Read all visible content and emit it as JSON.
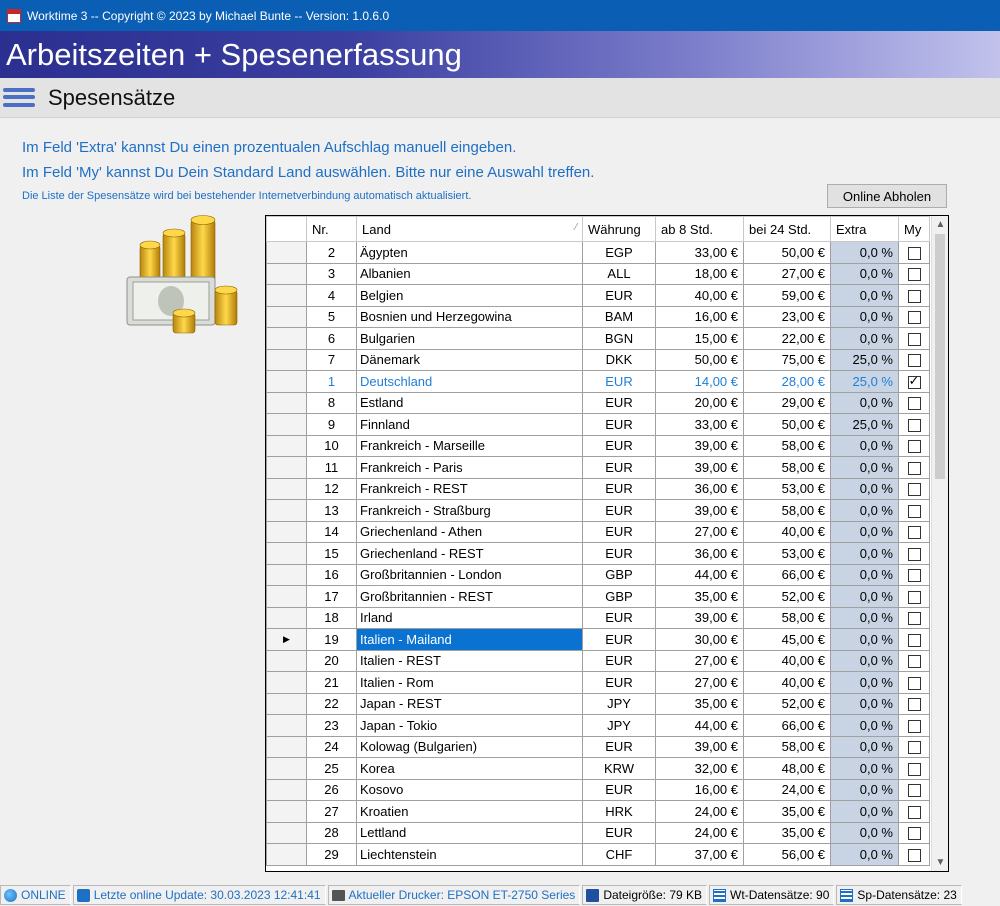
{
  "window": {
    "title": "Worktime 3 -- Copyright © 2023 by Michael Bunte -- Version: 1.0.6.0"
  },
  "banner": {
    "title": "Arbeitszeiten + Spesenerfassung"
  },
  "subheader": {
    "title": "Spesensätze"
  },
  "info": {
    "line1": "Im Feld 'Extra' kannst Du einen prozentualen Aufschlag manuell eingeben.",
    "line2": "Im Feld 'My' kannst Du Dein Standard Land auswählen. Bitte nur eine Auswahl treffen.",
    "line3": "Die Liste der Spesensätze wird bei bestehender Internetverbindung automatisch aktualisiert."
  },
  "buttons": {
    "online": "Online Abholen"
  },
  "grid": {
    "headers": {
      "nr": "Nr.",
      "land": "Land",
      "waehrung": "Währung",
      "ab8": "ab 8 Std.",
      "bei24": "bei 24 Std.",
      "extra": "Extra",
      "my": "My"
    },
    "rows": [
      {
        "nr": "2",
        "land": "Ägypten",
        "cur": "EGP",
        "ab8": "33,00 €",
        "bei24": "50,00 €",
        "extra": "0,0 %",
        "my": false
      },
      {
        "nr": "3",
        "land": "Albanien",
        "cur": "ALL",
        "ab8": "18,00 €",
        "bei24": "27,00 €",
        "extra": "0,0 %",
        "my": false
      },
      {
        "nr": "4",
        "land": "Belgien",
        "cur": "EUR",
        "ab8": "40,00 €",
        "bei24": "59,00 €",
        "extra": "0,0 %",
        "my": false
      },
      {
        "nr": "5",
        "land": "Bosnien und Herzegowina",
        "cur": "BAM",
        "ab8": "16,00 €",
        "bei24": "23,00 €",
        "extra": "0,0 %",
        "my": false
      },
      {
        "nr": "6",
        "land": "Bulgarien",
        "cur": "BGN",
        "ab8": "15,00 €",
        "bei24": "22,00 €",
        "extra": "0,0 %",
        "my": false
      },
      {
        "nr": "7",
        "land": "Dänemark",
        "cur": "DKK",
        "ab8": "50,00 €",
        "bei24": "75,00 €",
        "extra": "25,0 %",
        "my": false
      },
      {
        "nr": "1",
        "land": "Deutschland",
        "cur": "EUR",
        "ab8": "14,00 €",
        "bei24": "28,00 €",
        "extra": "25,0 %",
        "my": true,
        "highlight": true
      },
      {
        "nr": "8",
        "land": "Estland",
        "cur": "EUR",
        "ab8": "20,00 €",
        "bei24": "29,00 €",
        "extra": "0,0 %",
        "my": false
      },
      {
        "nr": "9",
        "land": "Finnland",
        "cur": "EUR",
        "ab8": "33,00 €",
        "bei24": "50,00 €",
        "extra": "25,0 %",
        "my": false
      },
      {
        "nr": "10",
        "land": "Frankreich - Marseille",
        "cur": "EUR",
        "ab8": "39,00 €",
        "bei24": "58,00 €",
        "extra": "0,0 %",
        "my": false
      },
      {
        "nr": "11",
        "land": "Frankreich - Paris",
        "cur": "EUR",
        "ab8": "39,00 €",
        "bei24": "58,00 €",
        "extra": "0,0 %",
        "my": false
      },
      {
        "nr": "12",
        "land": "Frankreich - REST",
        "cur": "EUR",
        "ab8": "36,00 €",
        "bei24": "53,00 €",
        "extra": "0,0 %",
        "my": false
      },
      {
        "nr": "13",
        "land": "Frankreich - Straßburg",
        "cur": "EUR",
        "ab8": "39,00 €",
        "bei24": "58,00 €",
        "extra": "0,0 %",
        "my": false
      },
      {
        "nr": "14",
        "land": "Griechenland - Athen",
        "cur": "EUR",
        "ab8": "27,00 €",
        "bei24": "40,00 €",
        "extra": "0,0 %",
        "my": false
      },
      {
        "nr": "15",
        "land": "Griechenland - REST",
        "cur": "EUR",
        "ab8": "36,00 €",
        "bei24": "53,00 €",
        "extra": "0,0 %",
        "my": false
      },
      {
        "nr": "16",
        "land": "Großbritannien - London",
        "cur": "GBP",
        "ab8": "44,00 €",
        "bei24": "66,00 €",
        "extra": "0,0 %",
        "my": false
      },
      {
        "nr": "17",
        "land": "Großbritannien - REST",
        "cur": "GBP",
        "ab8": "35,00 €",
        "bei24": "52,00 €",
        "extra": "0,0 %",
        "my": false
      },
      {
        "nr": "18",
        "land": "Irland",
        "cur": "EUR",
        "ab8": "39,00 €",
        "bei24": "58,00 €",
        "extra": "0,0 %",
        "my": false
      },
      {
        "nr": "19",
        "land": "Italien - Mailand",
        "cur": "EUR",
        "ab8": "30,00 €",
        "bei24": "45,00 €",
        "extra": "0,0 %",
        "my": false,
        "selected": true
      },
      {
        "nr": "20",
        "land": "Italien - REST",
        "cur": "EUR",
        "ab8": "27,00 €",
        "bei24": "40,00 €",
        "extra": "0,0 %",
        "my": false
      },
      {
        "nr": "21",
        "land": "Italien - Rom",
        "cur": "EUR",
        "ab8": "27,00 €",
        "bei24": "40,00 €",
        "extra": "0,0 %",
        "my": false
      },
      {
        "nr": "22",
        "land": "Japan - REST",
        "cur": "JPY",
        "ab8": "35,00 €",
        "bei24": "52,00 €",
        "extra": "0,0 %",
        "my": false
      },
      {
        "nr": "23",
        "land": "Japan - Tokio",
        "cur": "JPY",
        "ab8": "44,00 €",
        "bei24": "66,00 €",
        "extra": "0,0 %",
        "my": false
      },
      {
        "nr": "24",
        "land": "Kolowag (Bulgarien)",
        "cur": "EUR",
        "ab8": "39,00 €",
        "bei24": "58,00 €",
        "extra": "0,0 %",
        "my": false
      },
      {
        "nr": "25",
        "land": "Korea",
        "cur": "KRW",
        "ab8": "32,00 €",
        "bei24": "48,00 €",
        "extra": "0,0 %",
        "my": false
      },
      {
        "nr": "26",
        "land": "Kosovo",
        "cur": "EUR",
        "ab8": "16,00 €",
        "bei24": "24,00 €",
        "extra": "0,0 %",
        "my": false
      },
      {
        "nr": "27",
        "land": "Kroatien",
        "cur": "HRK",
        "ab8": "24,00 €",
        "bei24": "35,00 €",
        "extra": "0,0 %",
        "my": false
      },
      {
        "nr": "28",
        "land": "Lettland",
        "cur": "EUR",
        "ab8": "24,00 €",
        "bei24": "35,00 €",
        "extra": "0,0 %",
        "my": false
      },
      {
        "nr": "29",
        "land": "Liechtenstein",
        "cur": "CHF",
        "ab8": "37,00 €",
        "bei24": "56,00 €",
        "extra": "0,0 %",
        "my": false
      }
    ]
  },
  "statusbar": {
    "online": "ONLINE",
    "update": "Letzte online Update: 30.03.2023 12:41:41",
    "printer": "Aktueller Drucker: EPSON ET-2750 Series",
    "filesize": "Dateigröße: 79 KB",
    "wt": "Wt-Datensätze: 90",
    "sp": "Sp-Datensätze: 23"
  },
  "icons": {
    "app": "calendar-icon",
    "menu": "hamburger-menu-icon",
    "coins": "coins-money-icon",
    "online": "globe-icon",
    "update": "update-icon",
    "printer": "printer-icon",
    "filesize": "disk-icon",
    "wt": "table-icon",
    "sp": "table-icon"
  },
  "colors": {
    "titlebar": "#0a5fb4",
    "accent": "#1f6fc5",
    "selection": "#0a72d1",
    "extra_column": "#c8d4e3"
  }
}
